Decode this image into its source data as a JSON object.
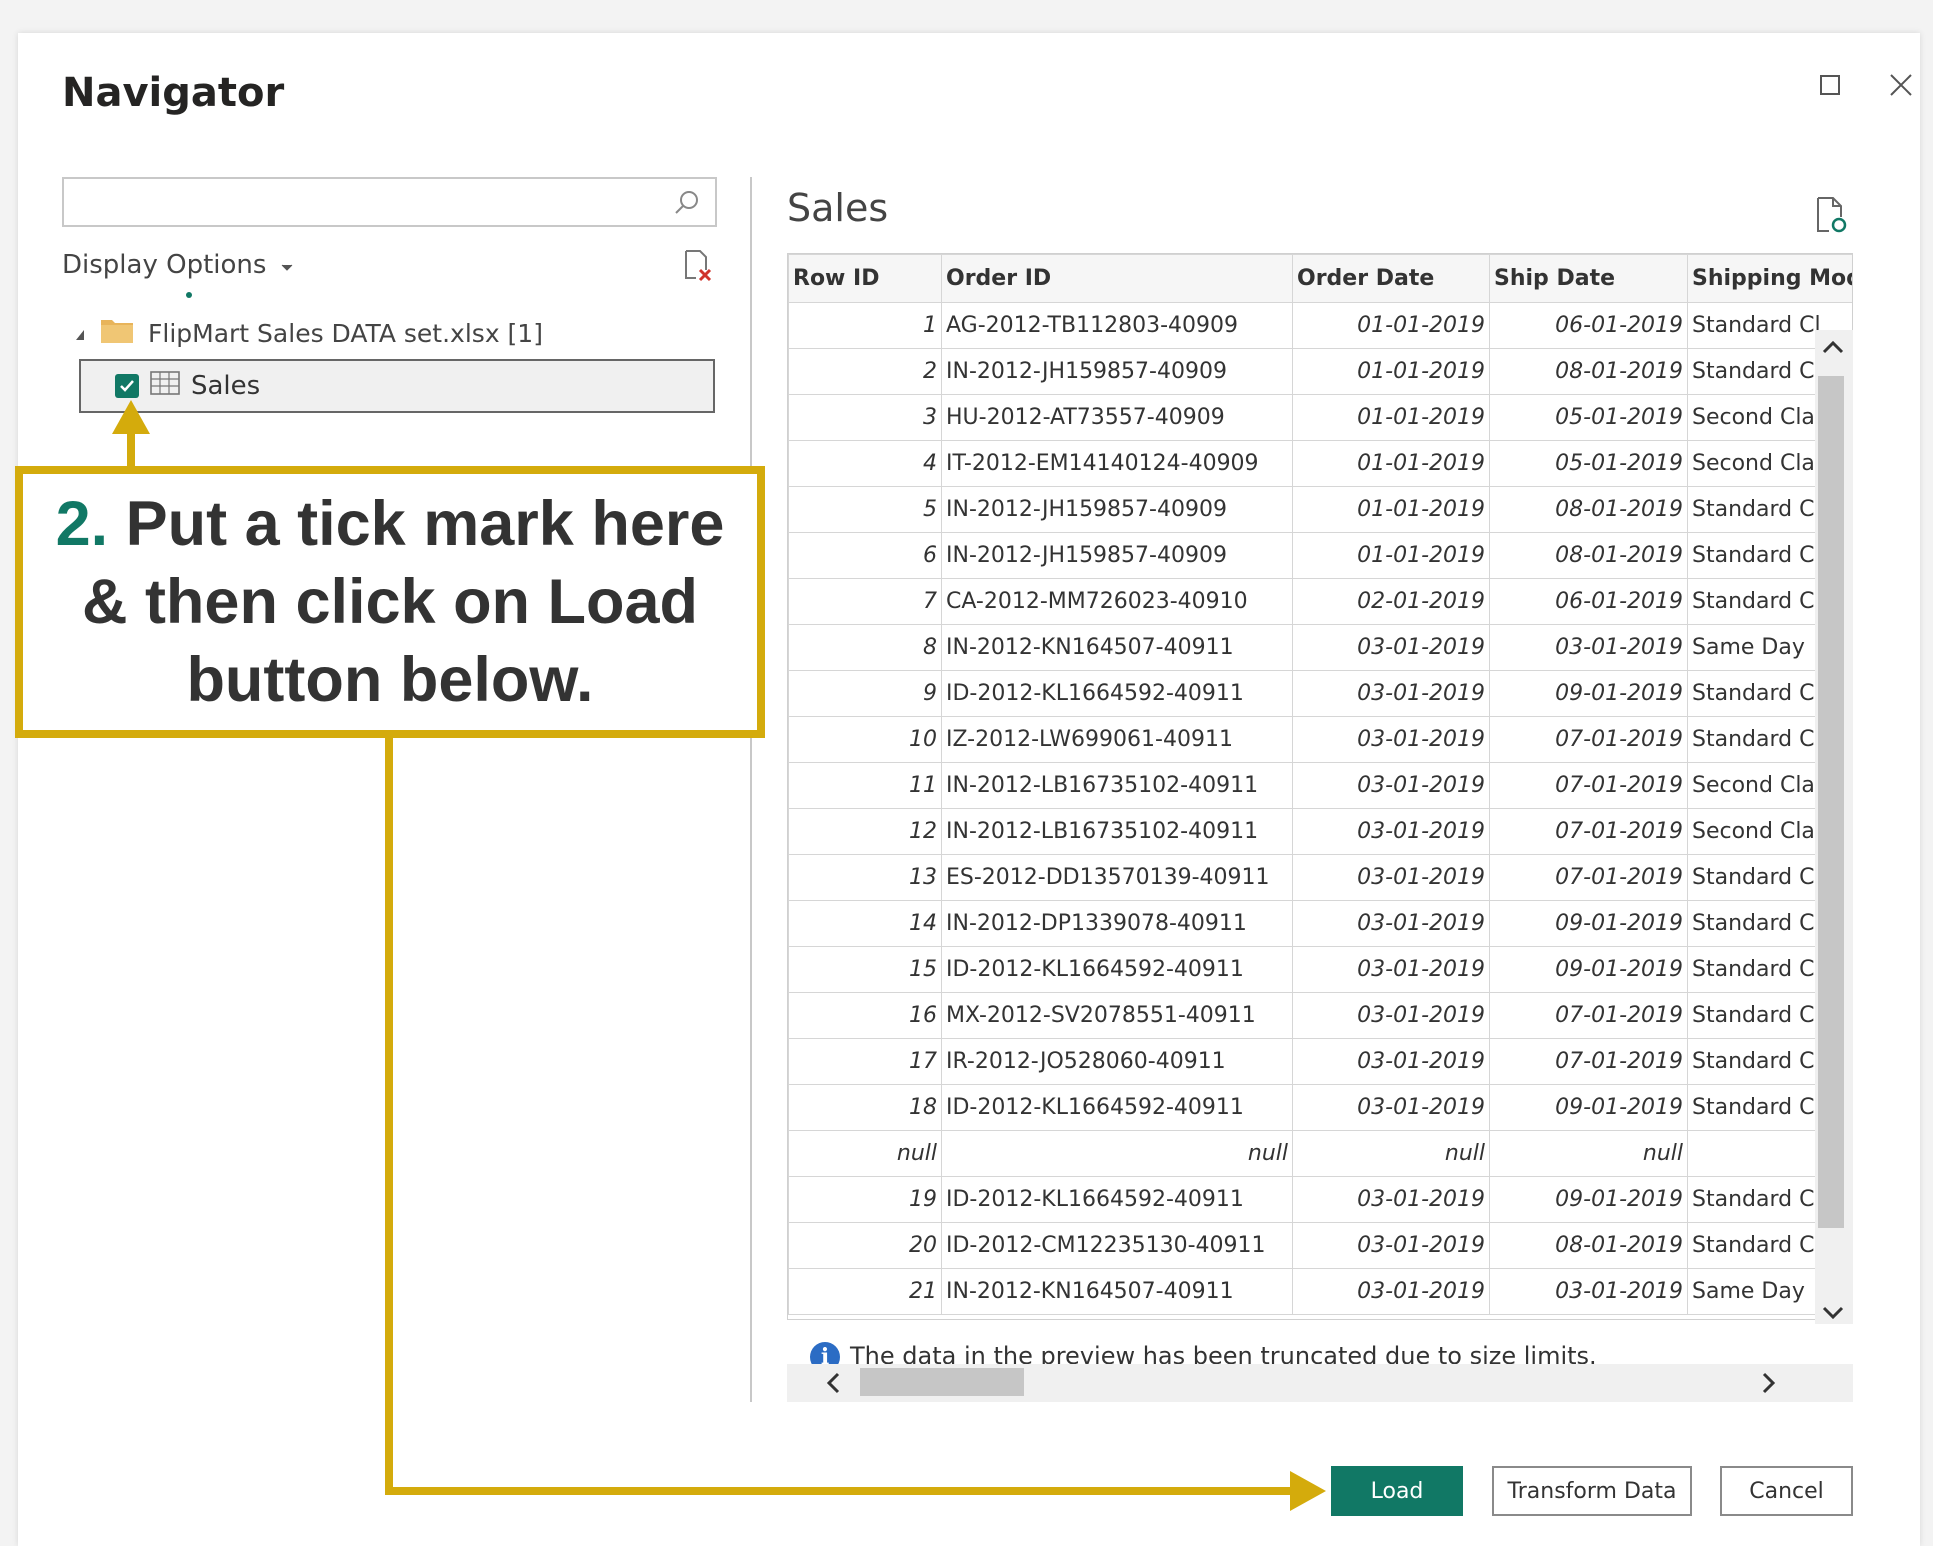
{
  "window": {
    "title": "Navigator",
    "maximize_icon": "maximize-icon",
    "close_icon": "close-icon"
  },
  "left_panel": {
    "search": {
      "value": "",
      "placeholder": ""
    },
    "display_options_label": "Display Options",
    "tree": {
      "file_label": "FlipMart Sales DATA set.xlsx [1]",
      "sales_label": "Sales",
      "sales_checked": true
    }
  },
  "preview": {
    "title": "Sales",
    "columns": [
      "Row ID",
      "Order ID",
      "Order Date",
      "Ship Date",
      "Shipping Mode"
    ],
    "rows": [
      [
        "1",
        "AG-2012-TB112803-40909",
        "01-01-2019",
        "06-01-2019",
        "Standard Cl"
      ],
      [
        "2",
        "IN-2012-JH159857-40909",
        "01-01-2019",
        "08-01-2019",
        "Standard Cl"
      ],
      [
        "3",
        "HU-2012-AT73557-40909",
        "01-01-2019",
        "05-01-2019",
        "Second Clas"
      ],
      [
        "4",
        "IT-2012-EM14140124-40909",
        "01-01-2019",
        "05-01-2019",
        "Second Clas"
      ],
      [
        "5",
        "IN-2012-JH159857-40909",
        "01-01-2019",
        "08-01-2019",
        "Standard Cl"
      ],
      [
        "6",
        "IN-2012-JH159857-40909",
        "01-01-2019",
        "08-01-2019",
        "Standard Cl"
      ],
      [
        "7",
        "CA-2012-MM726023-40910",
        "02-01-2019",
        "06-01-2019",
        "Standard Cl"
      ],
      [
        "8",
        "IN-2012-KN164507-40911",
        "03-01-2019",
        "03-01-2019",
        "Same Day"
      ],
      [
        "9",
        "ID-2012-KL1664592-40911",
        "03-01-2019",
        "09-01-2019",
        "Standard Cl"
      ],
      [
        "10",
        "IZ-2012-LW699061-40911",
        "03-01-2019",
        "07-01-2019",
        "Standard Cl"
      ],
      [
        "11",
        "IN-2012-LB16735102-40911",
        "03-01-2019",
        "07-01-2019",
        "Second Clas"
      ],
      [
        "12",
        "IN-2012-LB16735102-40911",
        "03-01-2019",
        "07-01-2019",
        "Second Clas"
      ],
      [
        "13",
        "ES-2012-DD13570139-40911",
        "03-01-2019",
        "07-01-2019",
        "Standard Cl"
      ],
      [
        "14",
        "IN-2012-DP1339078-40911",
        "03-01-2019",
        "09-01-2019",
        "Standard Cl"
      ],
      [
        "15",
        "ID-2012-KL1664592-40911",
        "03-01-2019",
        "09-01-2019",
        "Standard Cl"
      ],
      [
        "16",
        "MX-2012-SV2078551-40911",
        "03-01-2019",
        "07-01-2019",
        "Standard Cl"
      ],
      [
        "17",
        "IR-2012-JO528060-40911",
        "03-01-2019",
        "07-01-2019",
        "Standard Cl"
      ],
      [
        "18",
        "ID-2012-KL1664592-40911",
        "03-01-2019",
        "09-01-2019",
        "Standard Cl"
      ],
      [
        "null",
        "null",
        "null",
        "null",
        ""
      ],
      [
        "19",
        "ID-2012-KL1664592-40911",
        "03-01-2019",
        "09-01-2019",
        "Standard Cl"
      ],
      [
        "20",
        "ID-2012-CM12235130-40911",
        "03-01-2019",
        "08-01-2019",
        "Standard Cl"
      ],
      [
        "21",
        "IN-2012-KN164507-40911",
        "03-01-2019",
        "03-01-2019",
        "Same Day"
      ]
    ],
    "truncation_notice": "The data in the preview has been truncated due to size limits."
  },
  "buttons": {
    "load": "Load",
    "transform": "Transform Data",
    "cancel": "Cancel"
  },
  "callout": {
    "step": "2.",
    "line1": " Put a tick mark here",
    "line2": "& then click on Load",
    "line3": "button below."
  },
  "colors": {
    "accent": "#117865",
    "callout_border": "#d4ab0c",
    "info": "#2b6cc4"
  }
}
